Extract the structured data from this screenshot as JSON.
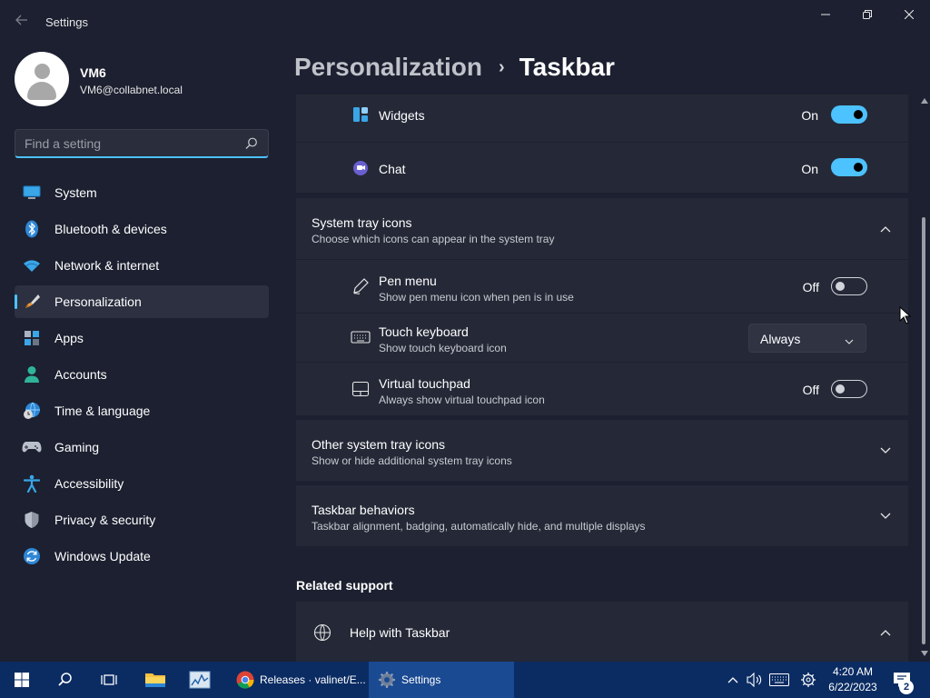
{
  "window": {
    "title": "Settings"
  },
  "user": {
    "name": "VM6",
    "email": "VM6@collabnet.local"
  },
  "search": {
    "placeholder": "Find a setting"
  },
  "sidebar": {
    "items": [
      {
        "label": "System",
        "icon": "monitor-icon"
      },
      {
        "label": "Bluetooth & devices",
        "icon": "bluetooth-icon"
      },
      {
        "label": "Network & internet",
        "icon": "wifi-icon"
      },
      {
        "label": "Personalization",
        "icon": "brush-icon",
        "active": true
      },
      {
        "label": "Apps",
        "icon": "apps-icon"
      },
      {
        "label": "Accounts",
        "icon": "person-icon"
      },
      {
        "label": "Time & language",
        "icon": "globe-clock-icon"
      },
      {
        "label": "Gaming",
        "icon": "gamepad-icon"
      },
      {
        "label": "Accessibility",
        "icon": "accessibility-icon"
      },
      {
        "label": "Privacy & security",
        "icon": "shield-icon"
      },
      {
        "label": "Windows Update",
        "icon": "update-icon"
      }
    ]
  },
  "breadcrumb": {
    "parent": "Personalization",
    "separator": "›",
    "current": "Taskbar"
  },
  "taskbar_items": {
    "widgets": {
      "label": "Widgets",
      "state": "On",
      "on": true
    },
    "chat": {
      "label": "Chat",
      "state": "On",
      "on": true
    }
  },
  "system_tray": {
    "title": "System tray icons",
    "subtitle": "Choose which icons can appear in the system tray",
    "expanded": true,
    "pen_menu": {
      "title": "Pen menu",
      "subtitle": "Show pen menu icon when pen is in use",
      "state": "Off",
      "on": false
    },
    "touch_keyboard": {
      "title": "Touch keyboard",
      "subtitle": "Show touch keyboard icon",
      "value": "Always"
    },
    "virtual_touchpad": {
      "title": "Virtual touchpad",
      "subtitle": "Always show virtual touchpad icon",
      "state": "Off",
      "on": false
    }
  },
  "other_tray": {
    "title": "Other system tray icons",
    "subtitle": "Show or hide additional system tray icons"
  },
  "behaviors": {
    "title": "Taskbar behaviors",
    "subtitle": "Taskbar alignment, badging, automatically hide, and multiple displays"
  },
  "related": {
    "heading": "Related support",
    "help_title": "Help with Taskbar"
  },
  "os_taskbar": {
    "apps": [
      {
        "label": "Releases · valinet/E...",
        "icon": "chrome-icon"
      },
      {
        "label": "Settings",
        "icon": "settings-gear-icon",
        "active": true
      }
    ],
    "time": "4:20 AM",
    "date": "6/22/2023",
    "notification_count": "2"
  },
  "colors": {
    "accent": "#4cc2ff",
    "window_bg": "#1c2030",
    "card_bg": "#252937",
    "taskbar_bg": "#0b2c63"
  }
}
